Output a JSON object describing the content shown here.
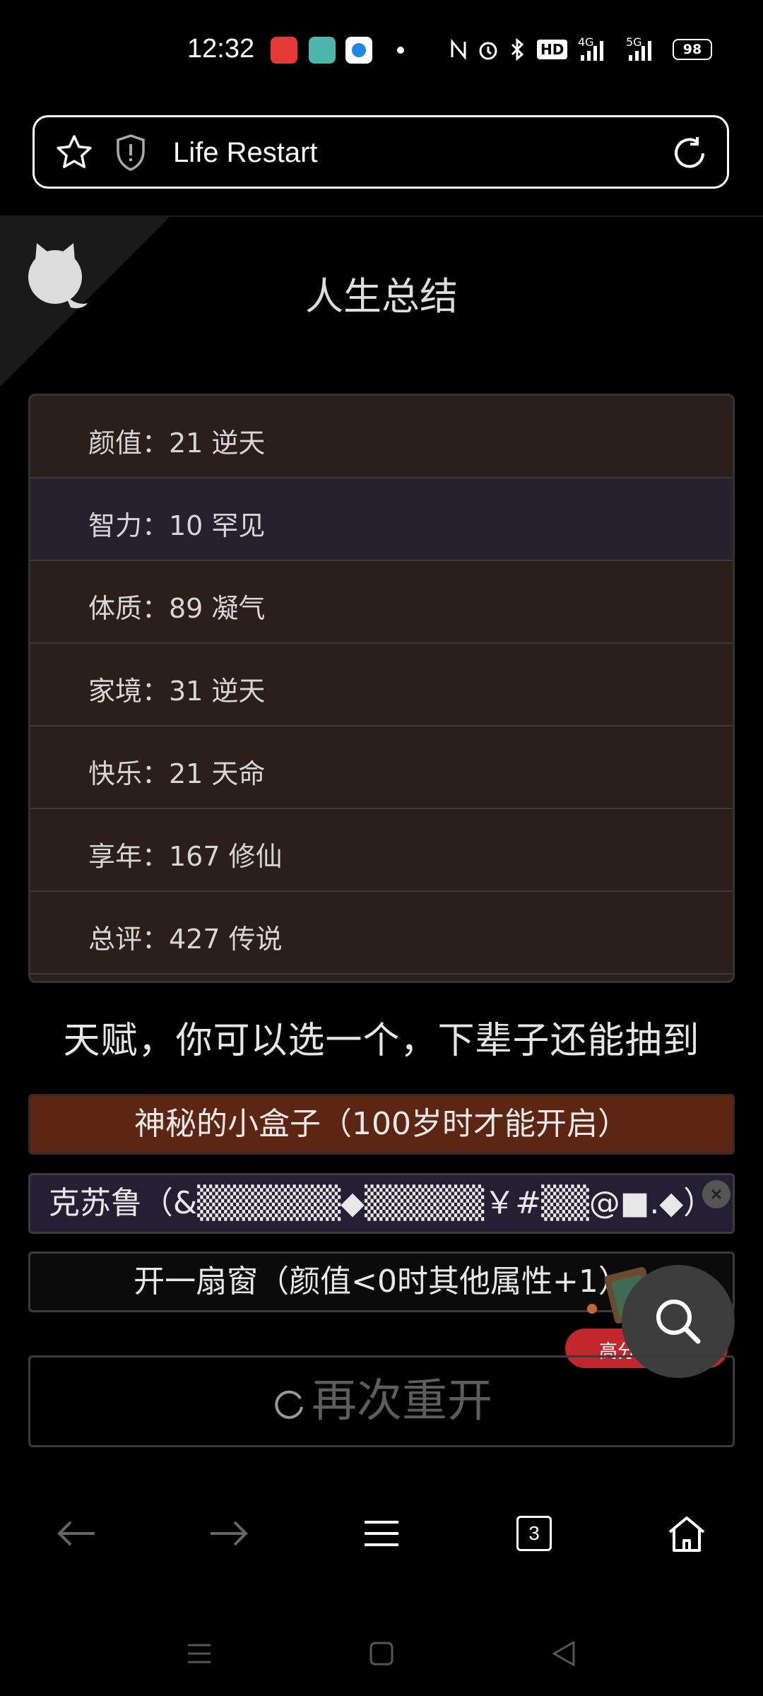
{
  "status_bar": {
    "time": "12:32",
    "network_1": "4G",
    "network_2": "5G",
    "hd_label": "HD",
    "battery": "98"
  },
  "url_bar": {
    "title": "Life Restart"
  },
  "page": {
    "title": "人生总结"
  },
  "summary": [
    {
      "label": "颜值：21 逆天"
    },
    {
      "label": "智力：10 罕见"
    },
    {
      "label": "体质：89 凝气"
    },
    {
      "label": "家境：31 逆天"
    },
    {
      "label": "快乐：21 天命"
    },
    {
      "label": "享年：167 修仙"
    },
    {
      "label": "总评：427 传说"
    }
  ],
  "talents": {
    "header": "天赋，你可以选一个，下辈子还能抽到",
    "items": [
      {
        "label": "神秘的小盒子（100岁时才能开启）"
      },
      {
        "label": "克苏鲁（&▒▒▒▒▒▒◆▒▒▒▒▒￥#▒▒@■.◆）"
      },
      {
        "label": "开一扇窗（颜值<0时其他属性+1）"
      }
    ]
  },
  "restart_button": {
    "label": "再次重开"
  },
  "ad": {
    "label": "高分"
  },
  "toolbar": {
    "tab_count": "3"
  },
  "colors": {
    "background": "#000000",
    "row": "#2a1f1a",
    "row_alt": "#25222d",
    "talent_selected": "#5c2612",
    "ad": "#c1272d"
  }
}
